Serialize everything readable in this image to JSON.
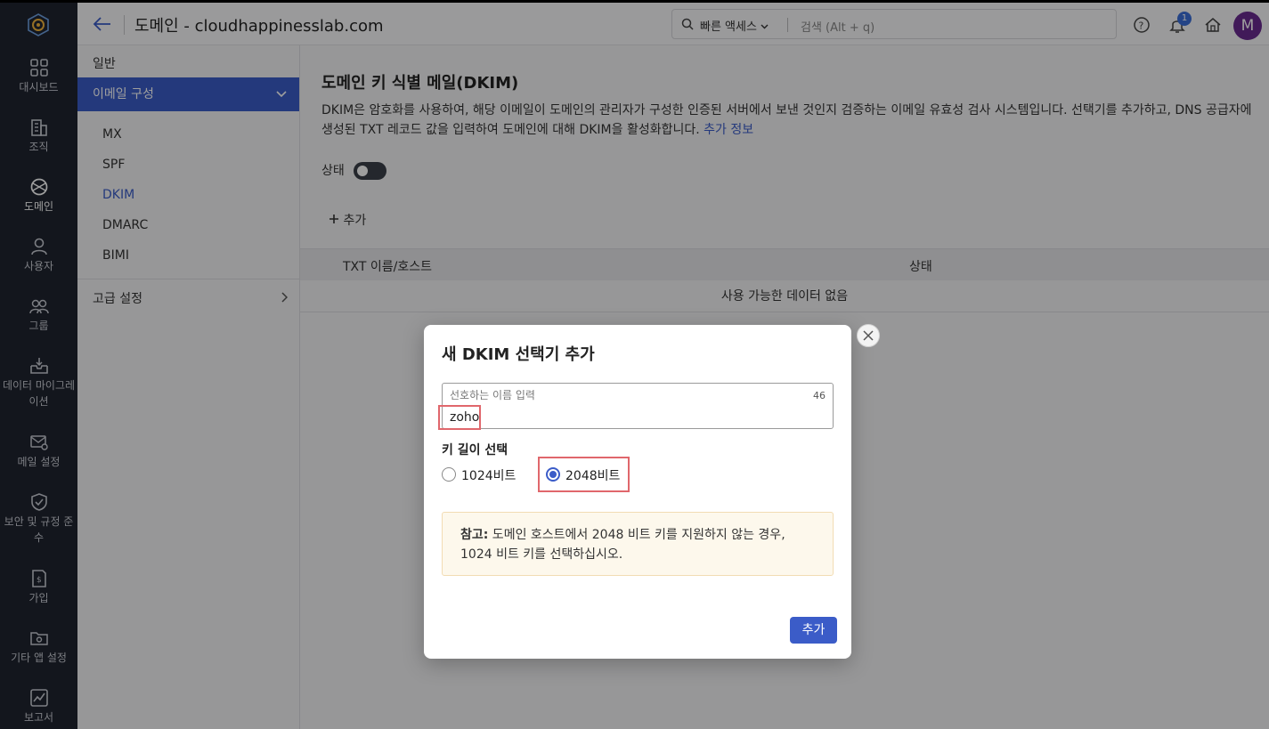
{
  "rail": {
    "items": [
      {
        "label": "대시보드",
        "icon": "dashboard-icon"
      },
      {
        "label": "조직",
        "icon": "building-icon"
      },
      {
        "label": "도메인",
        "icon": "globe-icon",
        "active": true
      },
      {
        "label": "사용자",
        "icon": "user-icon"
      },
      {
        "label": "그룹",
        "icon": "group-icon"
      },
      {
        "label": "데이터 마이그레이션",
        "icon": "inbox-download-icon"
      },
      {
        "label": "메일 설정",
        "icon": "mail-gear-icon"
      },
      {
        "label": "보안 및 규정 준수",
        "icon": "shield-check-icon"
      },
      {
        "label": "가입",
        "icon": "billing-icon"
      },
      {
        "label": "기타 앱 설정",
        "icon": "folder-gear-icon"
      },
      {
        "label": "보고서",
        "icon": "report-chart-icon"
      }
    ]
  },
  "header": {
    "title": "도메인 - cloudhappinesslab.com",
    "quick_access": "빠른 액세스",
    "search_placeholder": "검색 (Alt + q)",
    "notification_count": "1",
    "avatar_initial": "M"
  },
  "subnav": {
    "general": "일반",
    "group_label": "이메일 구성",
    "items": [
      {
        "label": "MX"
      },
      {
        "label": "SPF"
      },
      {
        "label": "DKIM",
        "active": true
      },
      {
        "label": "DMARC"
      },
      {
        "label": "BIMI"
      }
    ],
    "advanced": "고급 설정"
  },
  "main": {
    "title": "도메인 키 식별 메일(DKIM)",
    "description": "DKIM은 암호화를 사용하여, 해당 이메일이 도메인의 관리자가 구성한 인증된 서버에서 보낸 것인지 검증하는 이메일 유효성 검사 시스템입니다. 선택기를 추가하고, DNS 공급자에 생성된 TXT 레코드 값을 입력하여 도메인에 대해 DKIM을 활성화합니다.",
    "more_info": "추가 정보",
    "status_label": "상태",
    "add_label": "추가",
    "table": {
      "col_name": "TXT 이름/호스트",
      "col_status": "상태",
      "empty": "사용 가능한 데이터 없음"
    }
  },
  "modal": {
    "title": "새 DKIM 선택기 추가",
    "field_label": "선호하는 이름 입력",
    "field_counter": "46",
    "field_value": "zoho",
    "key_length_label": "키 길이 선택",
    "option_1024": "1024비트",
    "option_2048": "2048비트",
    "selected_option": "2048비트",
    "note_prefix": "참고:",
    "note_text": " 도메인 호스트에서 2048 비트 키를 지원하지 않는 경우, 1024 비트 키를 선택하십시오.",
    "add_button": "추가"
  },
  "colors": {
    "accent": "#3b5cc8",
    "rail_bg": "#1f2430",
    "highlight": "#e0676c",
    "avatar": "#6a2a90"
  }
}
